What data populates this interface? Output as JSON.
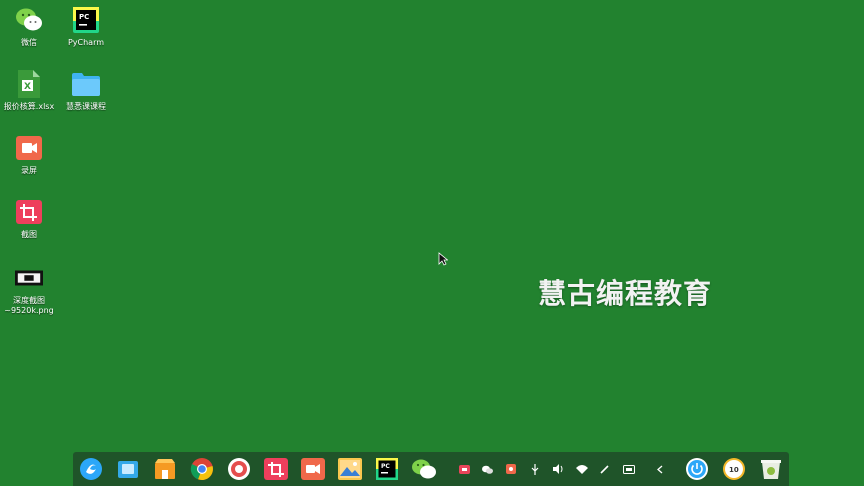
{
  "desktop": {
    "icons": [
      {
        "label": "微信"
      },
      {
        "label": "PyCharm"
      },
      {
        "label": "报价核算.xlsx"
      },
      {
        "label": "慧悉课课程"
      },
      {
        "label": "录屏"
      },
      {
        "label": "截图"
      },
      {
        "label": "深度截图\n~9520k.png"
      }
    ],
    "watermark": "慧古编程教育"
  },
  "taskbar": {
    "apps": [
      "launcher-icon",
      "file-manager-icon",
      "app-store-icon",
      "chrome-icon",
      "settings-icon",
      "screenshot-icon",
      "screen-recorder-icon",
      "image-viewer-icon",
      "pycharm-icon",
      "wechat-icon"
    ],
    "tray": [
      "recorder-tray-icon",
      "wechat-tray-icon",
      "tray-app-icon",
      "usb-icon",
      "volume-icon",
      "wifi-icon",
      "pen-icon",
      "keyboard-icon",
      "collapse-arrow-icon"
    ],
    "clock_text": "10",
    "colors": {
      "accent": "#2ca7f8",
      "desktop": "#22822f"
    }
  }
}
